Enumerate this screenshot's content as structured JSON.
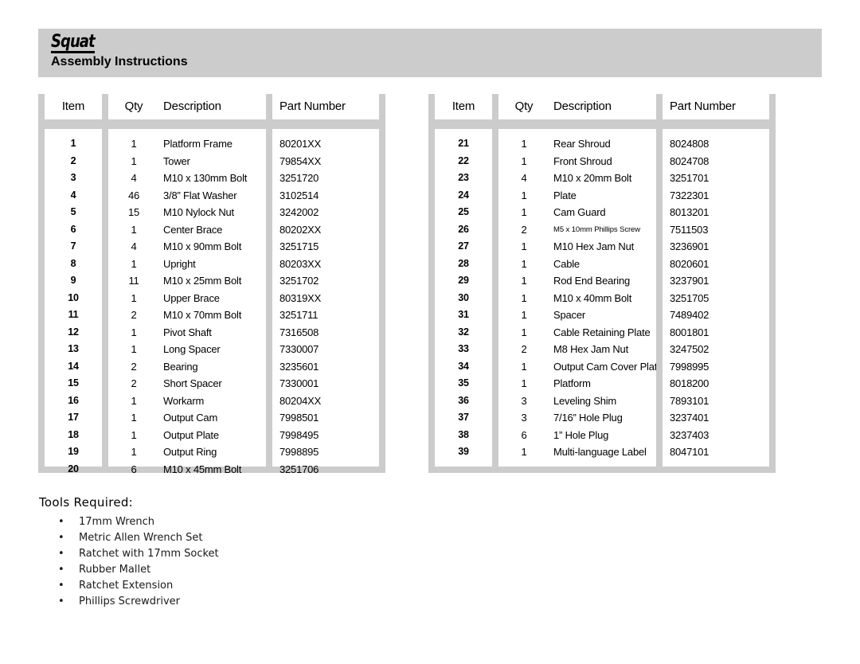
{
  "header": {
    "logo_text": "Squat",
    "subtitle": "Assembly Instructions",
    "band_color": "#cccccc"
  },
  "parts_tables": [
    {
      "id": "parts-table-1",
      "columns": [
        "Item",
        "Qty",
        "Description",
        "Part Number"
      ],
      "rows": [
        {
          "item": "1",
          "qty": "1",
          "description": "Platform Frame",
          "part_number": "80201XX"
        },
        {
          "item": "2",
          "qty": "1",
          "description": "Tower",
          "part_number": "79854XX"
        },
        {
          "item": "3",
          "qty": "4",
          "description": "M10 x 130mm Bolt",
          "part_number": "3251720"
        },
        {
          "item": "4",
          "qty": "46",
          "description": "3/8” Flat Washer",
          "part_number": "3102514"
        },
        {
          "item": "5",
          "qty": "15",
          "description": "M10 Nylock Nut",
          "part_number": "3242002"
        },
        {
          "item": "6",
          "qty": "1",
          "description": "Center Brace",
          "part_number": "80202XX"
        },
        {
          "item": "7",
          "qty": "4",
          "description": "M10 x 90mm Bolt",
          "part_number": "3251715"
        },
        {
          "item": "8",
          "qty": "1",
          "description": "Upright",
          "part_number": "80203XX"
        },
        {
          "item": "9",
          "qty": "11",
          "description": "M10 x 25mm Bolt",
          "part_number": "3251702"
        },
        {
          "item": "10",
          "qty": "1",
          "description": "Upper Brace",
          "part_number": "80319XX"
        },
        {
          "item": "11",
          "qty": "2",
          "description": "M10 x 70mm Bolt",
          "part_number": "3251711"
        },
        {
          "item": "12",
          "qty": "1",
          "description": "Pivot Shaft",
          "part_number": "7316508"
        },
        {
          "item": "13",
          "qty": "1",
          "description": "Long Spacer",
          "part_number": "7330007"
        },
        {
          "item": "14",
          "qty": "2",
          "description": "Bearing",
          "part_number": "3235601"
        },
        {
          "item": "15",
          "qty": "2",
          "description": "Short Spacer",
          "part_number": "7330001"
        },
        {
          "item": "16",
          "qty": "1",
          "description": "Workarm",
          "part_number": "80204XX"
        },
        {
          "item": "17",
          "qty": "1",
          "description": "Output Cam",
          "part_number": "7998501"
        },
        {
          "item": "18",
          "qty": "1",
          "description": "Output Plate",
          "part_number": "7998495"
        },
        {
          "item": "19",
          "qty": "1",
          "description": "Output Ring",
          "part_number": "7998895"
        },
        {
          "item": "20",
          "qty": "6",
          "description": "M10 x 45mm Bolt",
          "part_number": "3251706"
        }
      ]
    },
    {
      "id": "parts-table-2",
      "columns": [
        "Item",
        "Qty",
        "Description",
        "Part Number"
      ],
      "rows": [
        {
          "item": "21",
          "qty": "1",
          "description": "Rear Shroud",
          "part_number": "8024808"
        },
        {
          "item": "22",
          "qty": "1",
          "description": "Front Shroud",
          "part_number": "8024708"
        },
        {
          "item": "23",
          "qty": "4",
          "description": "M10 x 20mm Bolt",
          "part_number": "3251701"
        },
        {
          "item": "24",
          "qty": "1",
          "description": "Plate",
          "part_number": "7322301"
        },
        {
          "item": "25",
          "qty": "1",
          "description": "Cam Guard",
          "part_number": "8013201"
        },
        {
          "item": "26",
          "qty": "2",
          "description": "M5 x 10mm Phillips Screw",
          "part_number": "7511503",
          "small": true
        },
        {
          "item": "27",
          "qty": "1",
          "description": "M10 Hex Jam Nut",
          "part_number": "3236901"
        },
        {
          "item": "28",
          "qty": "1",
          "description": "Cable",
          "part_number": "8020601"
        },
        {
          "item": "29",
          "qty": "1",
          "description": "Rod End Bearing",
          "part_number": "3237901"
        },
        {
          "item": "30",
          "qty": "1",
          "description": "M10 x 40mm Bolt",
          "part_number": "3251705"
        },
        {
          "item": "31",
          "qty": "1",
          "description": "Spacer",
          "part_number": "7489402"
        },
        {
          "item": "32",
          "qty": "1",
          "description": "Cable Retaining Plate",
          "part_number": "8001801"
        },
        {
          "item": "33",
          "qty": "2",
          "description": "M8 Hex Jam Nut",
          "part_number": "3247502"
        },
        {
          "item": "34",
          "qty": "1",
          "description": "Output Cam Cover Plate",
          "part_number": "7998995"
        },
        {
          "item": "35",
          "qty": "1",
          "description": "Platform",
          "part_number": "8018200"
        },
        {
          "item": "36",
          "qty": "3",
          "description": "Leveling Shim",
          "part_number": "7893101"
        },
        {
          "item": "37",
          "qty": "3",
          "description": "7/16” Hole Plug",
          "part_number": "3237401"
        },
        {
          "item": "38",
          "qty": "6",
          "description": "1” Hole Plug",
          "part_number": "3237403"
        },
        {
          "item": "39",
          "qty": "1",
          "description": "Multi-language Label",
          "part_number": "8047101"
        }
      ]
    }
  ],
  "tools": {
    "title": "Tools Required:",
    "bullet_glyph": "•",
    "items": [
      "17mm Wrench",
      "Metric Allen Wrench Set",
      "Ratchet with 17mm Socket",
      "Rubber Mallet",
      "Ratchet Extension",
      "Phillips Screwdriver"
    ]
  }
}
